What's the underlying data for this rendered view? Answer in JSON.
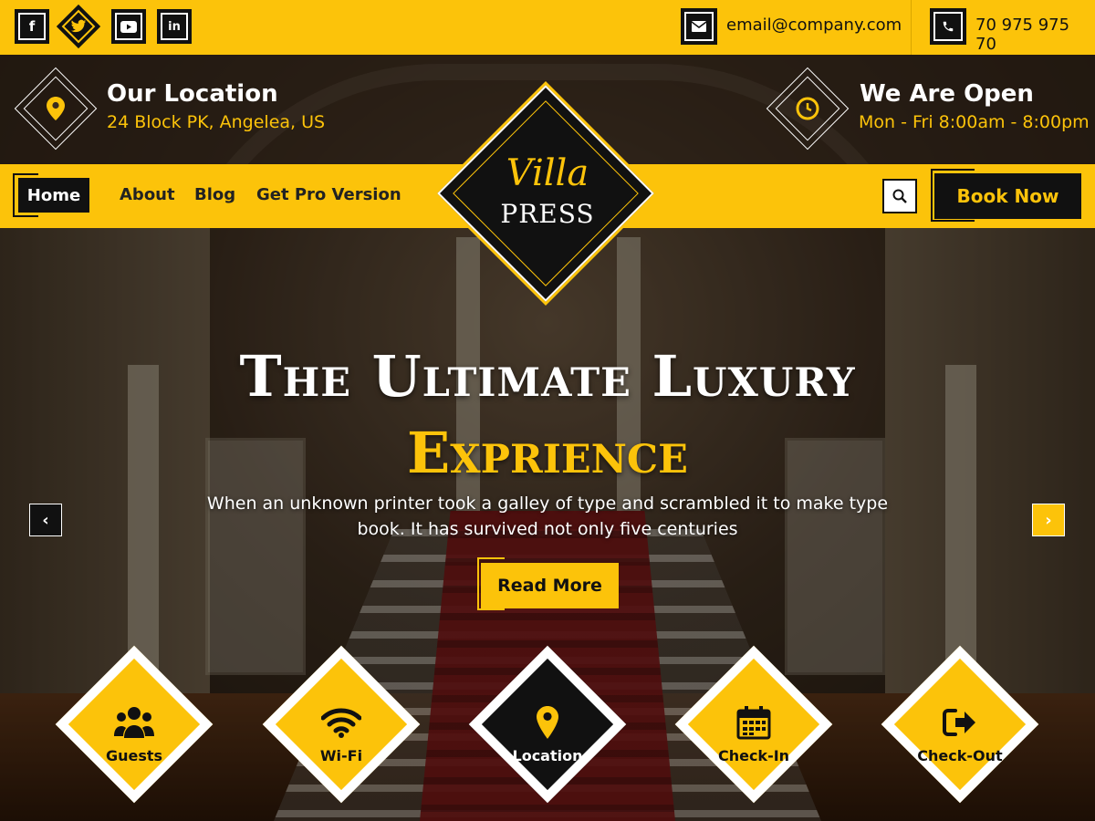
{
  "topbar": {
    "social": [
      "facebook-icon",
      "twitter-icon",
      "youtube-icon",
      "linkedin-icon"
    ],
    "email": "email@company.com",
    "phone": "70 975 975 70"
  },
  "info": {
    "location_title": "Our Location",
    "location_value": "24 Block  PK, Angelea, US",
    "hours_title": "We Are Open",
    "hours_value": "Mon - Fri 8:00am - 8:00pm"
  },
  "nav": {
    "items": [
      "Home",
      "About",
      "Blog",
      "Get Pro Version"
    ],
    "book_now": "Book Now"
  },
  "logo": {
    "line1": "Villa",
    "line2": "PRESS"
  },
  "slide": {
    "title_line1": "The Ultimate Luxury",
    "title_line2": "Exprience",
    "description": "When an unknown printer took a galley of type and scrambled it to make type book. It has survived not only five centuries",
    "button": "Read More",
    "prev": "‹",
    "next": "›"
  },
  "features": [
    {
      "label": "Guests",
      "icon": "guests-icon"
    },
    {
      "label": "Wi-Fi",
      "icon": "wifi-icon"
    },
    {
      "label": "Location",
      "icon": "location-pin-icon"
    },
    {
      "label": "Check-In",
      "icon": "calendar-icon"
    },
    {
      "label": "Check-Out",
      "icon": "sign-out-icon"
    }
  ],
  "colors": {
    "accent": "#fcc30a",
    "dark": "#111111",
    "white": "#ffffff"
  }
}
